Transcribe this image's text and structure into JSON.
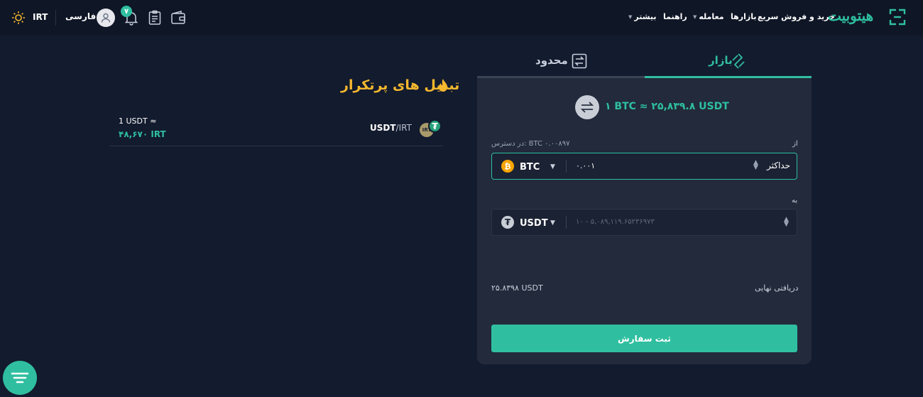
{
  "header": {
    "logo_text": "هیتوبیت",
    "nav": {
      "quick_buy": "خرید و فروش سریع",
      "markets": "بازارها",
      "trade": "معامله",
      "guide": "راهنما",
      "more": "بیشتر"
    },
    "currency": "IRT",
    "language": "فارسی",
    "notification_count": "۷",
    "icons": [
      "sun-icon",
      "user-icon",
      "bell-icon",
      "orders-icon",
      "wallet-icon",
      "logo-mark"
    ]
  },
  "popular": {
    "title": "تبدیل های پرتکرار",
    "pairs": [
      {
        "base": "USDT",
        "quote": "IRT",
        "rate_line1": "1 USDT ≈",
        "rate_line2": "۴۸,۶۷۰ IRT"
      }
    ]
  },
  "trade": {
    "tabs": {
      "market": "بازار",
      "limit": "محدود"
    },
    "rate": "۱ BTC ≈ ۲۵,۸۳۹.۸ USDT",
    "from": {
      "label": "از",
      "available": "در دسترس: BTC ۰.۰۰۸۹۷",
      "coin": "BTC",
      "amount": "۰.۰۰۱",
      "max": "حداکثر"
    },
    "to": {
      "label": "به",
      "coin": "USDT",
      "placeholder": "۱۰ - ۵,۰۸۹,۱۱۹.۶۵۲۳۶۹۷۳"
    },
    "final": {
      "label": "دریافتی نهایی",
      "value": "۲۵.۸۳۹۸ USDT"
    },
    "submit": "ثبت سفارش"
  },
  "colors": {
    "accent": "#2fbfa0",
    "warning": "#f5b82e",
    "background": "#131b2e",
    "panel": "#222a3b"
  }
}
